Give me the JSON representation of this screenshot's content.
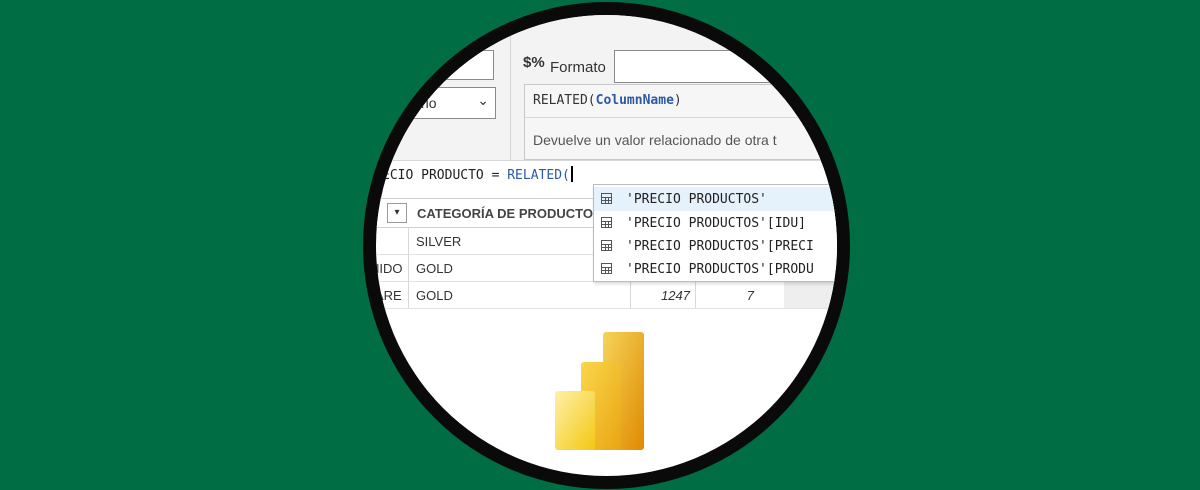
{
  "ribbon": {
    "left_select_text": "rio",
    "format_icon": "$%",
    "format_label": "Formato"
  },
  "tooltip": {
    "function_name": "RELATED",
    "open_paren": "(",
    "param": "ColumnName",
    "close_paren": ")",
    "description": "Devuelve un valor relacionado de otra t"
  },
  "formula_bar": {
    "prefix": "ECIO PRODUCTO = ",
    "function": "RELATED("
  },
  "autocomplete": {
    "items": [
      {
        "icon": "table-icon",
        "label": "'PRECIO PRODUCTOS'"
      },
      {
        "icon": "table-icon",
        "label": "'PRECIO PRODUCTOS'[IDU]"
      },
      {
        "icon": "table-icon",
        "label": "'PRECIO PRODUCTOS'[PRECI"
      },
      {
        "icon": "table-icon",
        "label": "'PRECIO PRODUCTOS'[PRODU"
      }
    ]
  },
  "table": {
    "column_header": "CATEGORÍA DE PRODUCTOS",
    "filter_icon": "▾",
    "rows": [
      {
        "col0": "",
        "category": "SILVER",
        "value1": "",
        "value2": ""
      },
      {
        "col0": "NIDO",
        "category": "GOLD",
        "value1": "",
        "value2": ""
      },
      {
        "col0": "ARE",
        "category": "GOLD",
        "value1": "1247",
        "value2": "7"
      }
    ]
  },
  "logo": {
    "name": "power-bi-logo",
    "colors": [
      "#f2c811",
      "#e8a317",
      "#d88a00",
      "#fbe27a"
    ]
  }
}
